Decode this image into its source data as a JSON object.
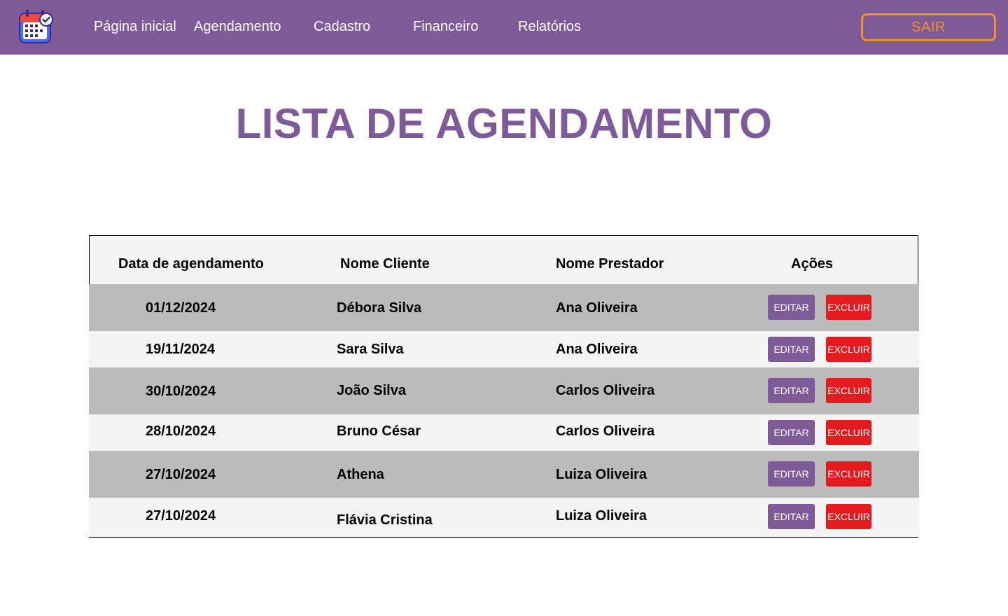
{
  "nav": {
    "logo_icon": "calendar-check-icon",
    "links": [
      "Página inicial",
      "Agendamento",
      "Cadastro",
      "Financeiro",
      "Relatórios"
    ],
    "logout_label": "SAIR"
  },
  "colors": {
    "brand": "#7f5a99",
    "logout": "#f0922e",
    "delete": "#e51a1e",
    "row_dark": "#bbbbbb",
    "row_light": "#f4f4f4"
  },
  "page": {
    "title": "LISTA DE AGENDAMENTO"
  },
  "table": {
    "headers": [
      "Data de agendamento",
      "Nome Cliente",
      "Nome Prestador",
      "Ações"
    ],
    "edit_label": "EDITAR",
    "delete_label": "EXCLUIR",
    "rows": [
      {
        "date": "01/12/2024",
        "client": "Débora Silva",
        "provider": "Ana Oliveira"
      },
      {
        "date": "19/11/2024",
        "client": "Sara Silva",
        "provider": "Ana Oliveira"
      },
      {
        "date": "30/10/2024",
        "client": "João Silva",
        "provider": "Carlos Oliveira"
      },
      {
        "date": "28/10/2024",
        "client": "Bruno César",
        "provider": "Carlos Oliveira"
      },
      {
        "date": "27/10/2024",
        "client": "Athena",
        "provider": "Luiza Oliveira"
      },
      {
        "date": "27/10/2024",
        "client": "Flávia Cristina",
        "provider": "Luiza Oliveira"
      }
    ]
  }
}
